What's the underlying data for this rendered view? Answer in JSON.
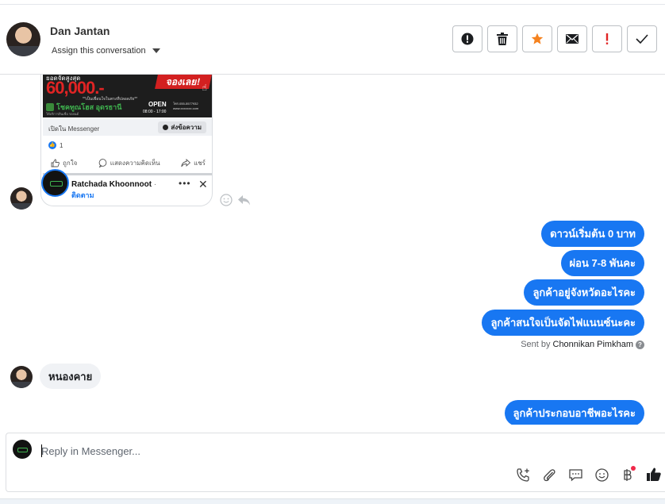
{
  "header": {
    "contact_name": "Dan Jantan",
    "assign_label": "Assign this conversation",
    "actions": [
      {
        "name": "mark-spam-button",
        "icon": "alert-circle-icon"
      },
      {
        "name": "delete-button",
        "icon": "trash-icon"
      },
      {
        "name": "star-button",
        "icon": "star-icon"
      },
      {
        "name": "mark-unread-button",
        "icon": "envelope-icon"
      },
      {
        "name": "follow-up-button",
        "icon": "exclamation-icon"
      },
      {
        "name": "mark-done-button",
        "icon": "checkmark-icon"
      }
    ]
  },
  "shared_post": {
    "banner_text": "60,000.-",
    "banner_small_text": "ยอดจัดสูงสุด",
    "banner_tag": "จองเลย!",
    "banner_tagline": "**เป็นเพื่อนใจในตรงที่ปลอดภัย**",
    "banner_logo": "โชคทูณโฮส อุดรธานี",
    "banner_logo_sub": "ให้บริการสินเชื่อ รถยนต์",
    "banner_open": "OPEN",
    "banner_hours": "08:00 - 17:00",
    "banner_contact": "โทร.055-5577932 www.xxxxxxx.com",
    "open_in_label": "เปิดใน Messenger",
    "send_button": "ส่งข้อความ",
    "reaction_count": "1",
    "like_label": "ถูกใจ",
    "comment_label": "แสดงความคิดเห็น",
    "share_label": "แชร์",
    "profile_name": "Ratchada Khoonnoot",
    "profile_name_suffix": "·",
    "follow_label": "ติดตาม"
  },
  "outgoing_messages": [
    "ดาวน์เริ่มต้น 0 บาท",
    "ผ่อน 7-8 พันคะ",
    "ลูกค้าอยู่จังหวัดอะไรคะ",
    "ลูกค้าสนใจเป็นจัดไฟแนนซ์นะคะ"
  ],
  "sent_by": {
    "prefix": "Sent by",
    "name": "Chonnikan Pimkham",
    "help": "?"
  },
  "incoming_message": "หนองคาย",
  "last_outgoing": "ลูกค้าประกอบอาชีพอะไรคะ",
  "composer": {
    "placeholder": "Reply in Messenger..."
  },
  "colors": {
    "accent": "#1877f2",
    "star": "#f5821f",
    "flag": "#e02424",
    "notification": "#f02849"
  }
}
